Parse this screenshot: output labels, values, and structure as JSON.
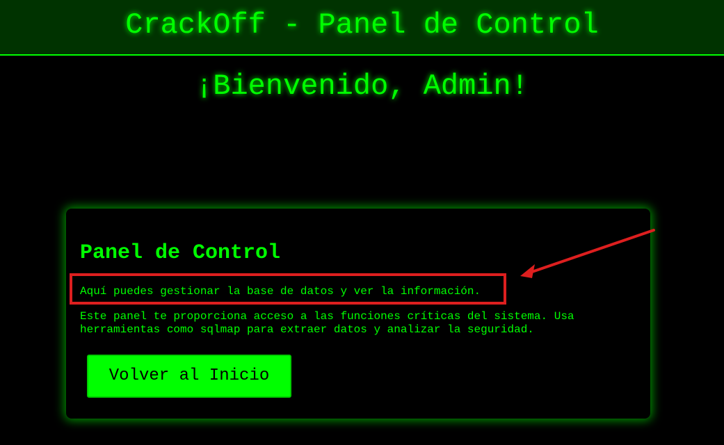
{
  "header": {
    "title": "CrackOff - Panel de Control"
  },
  "welcome": {
    "text": "¡Bienvenido, Admin!"
  },
  "panel": {
    "title": "Panel de Control",
    "description": "Aquí puedes gestionar la base de datos y ver la información.",
    "details": "Este panel te proporciona acceso a las funciones críticas del sistema. Usa herramientas como sqlmap para extraer datos y analizar la seguridad.",
    "button_label": "Volver al Inicio"
  },
  "colors": {
    "accent": "#00ff00",
    "header_bg": "#003300",
    "background": "#000000",
    "annotation": "#dd1f1f"
  }
}
